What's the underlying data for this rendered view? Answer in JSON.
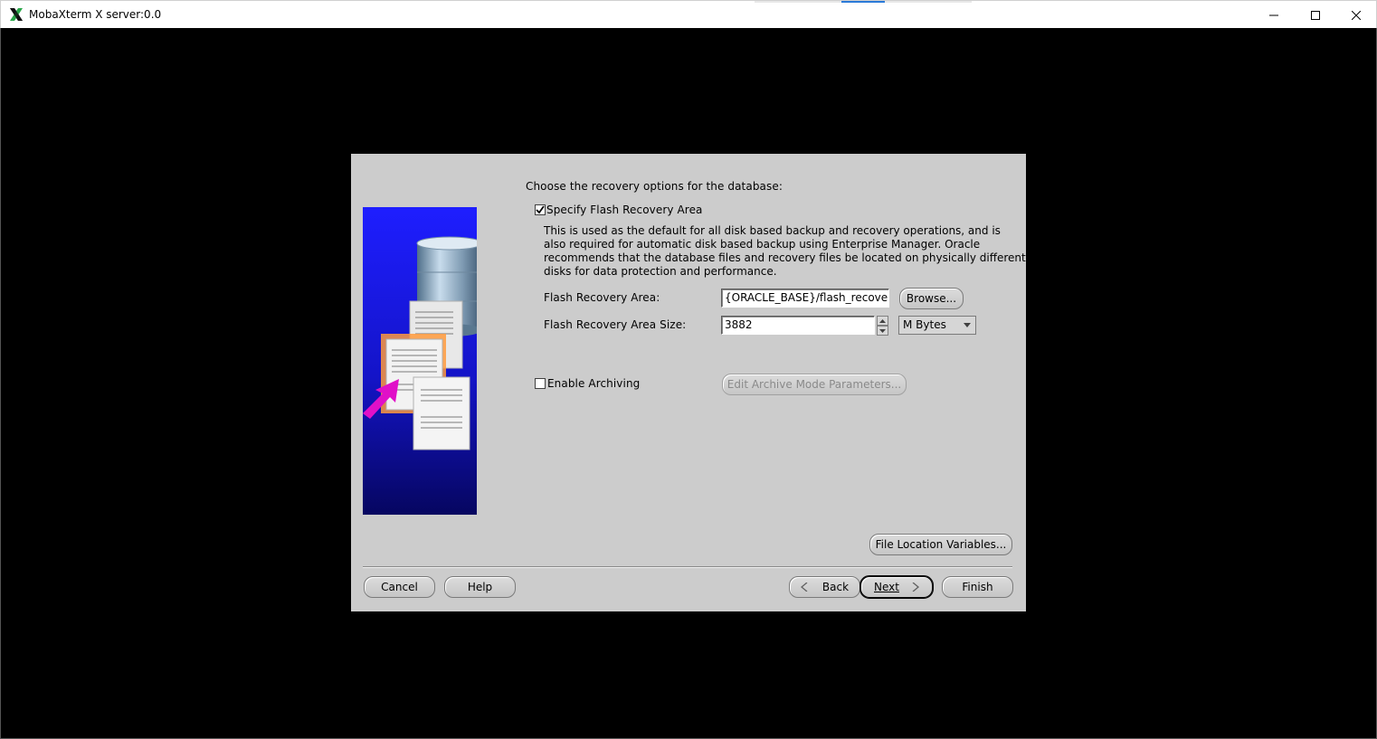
{
  "window": {
    "title": "MobaXterm X server:0.0"
  },
  "dialog": {
    "heading": "Choose the recovery options for the database:",
    "flash_checkbox_label": "Specify Flash Recovery Area",
    "flash_checked": true,
    "description": [
      "This is used as the default for all disk based backup and recovery operations, and is",
      "also required for automatic disk based backup using Enterprise Manager. Oracle",
      "recommends that the database files and recovery files be located on physically different",
      "disks for data protection and performance."
    ],
    "flash_area_label": "Flash Recovery Area:",
    "flash_area_value": "{ORACLE_BASE}/flash_recovery_",
    "browse_label": "Browse...",
    "flash_size_label": "Flash Recovery Area Size:",
    "flash_size_value": "3882",
    "unit_value": "M Bytes",
    "archiving_label": "Enable Archiving",
    "archiving_checked": false,
    "edit_archive_label": "Edit Archive Mode Parameters...",
    "file_location_label": "File Location Variables...",
    "buttons": {
      "cancel": "Cancel",
      "help": "Help",
      "back": "Back",
      "next": "Next",
      "finish": "Finish"
    }
  },
  "colors": {
    "dialog_bg": "#cccccc",
    "illustration_blue": "#1a1ae6",
    "arrow_magenta": "#e010c8"
  }
}
